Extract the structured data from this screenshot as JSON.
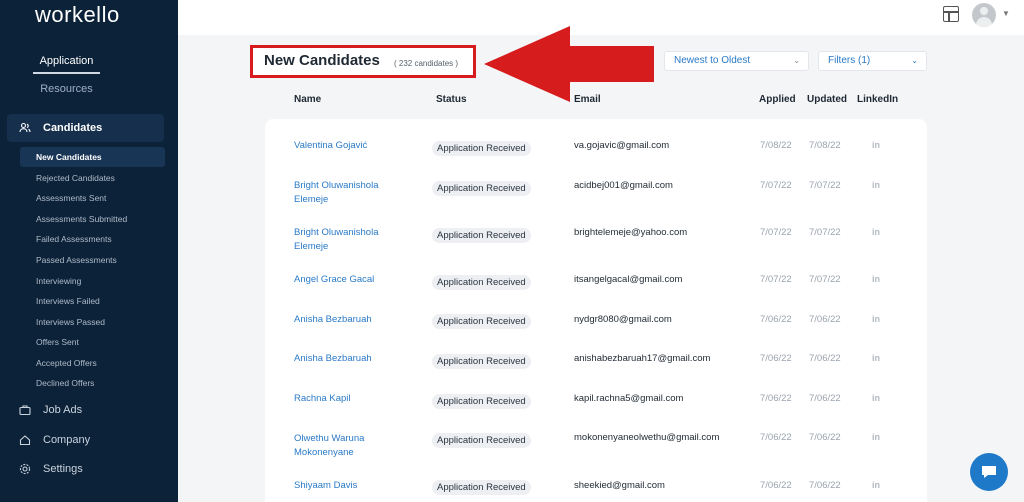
{
  "app": {
    "logo": "workello"
  },
  "topnav": {
    "application": "Application",
    "resources": "Resources"
  },
  "sidebar": {
    "candidates_label": "Candidates",
    "sub_items": [
      "New Candidates",
      "Rejected Candidates",
      "Assessments Sent",
      "Assessments Submitted",
      "Failed Assessments",
      "Passed Assessments",
      "Interviewing",
      "Interviews Failed",
      "Interviews Passed",
      "Offers Sent",
      "Accepted Offers",
      "Declined Offers"
    ],
    "job_ads": "Job Ads",
    "company": "Company",
    "settings": "Settings"
  },
  "page": {
    "title": "New Candidates",
    "count": "( 232 candidates )"
  },
  "controls": {
    "sort": "Newest to Oldest",
    "filters": "Filters (1)"
  },
  "headers": {
    "name": "Name",
    "status": "Status",
    "email": "Email",
    "applied": "Applied",
    "updated": "Updated",
    "linkedin": "LinkedIn"
  },
  "rows": [
    {
      "name": "Valentina Gojavić",
      "status": "Application Received",
      "email": "va.gojavic@gmail.com",
      "applied": "7/08/22",
      "updated": "7/08/22",
      "linkedin": "in"
    },
    {
      "name": "Bright Oluwanishola Elemeje",
      "status": "Application Received",
      "email": "acidbej001@gmail.com",
      "applied": "7/07/22",
      "updated": "7/07/22",
      "linkedin": "in"
    },
    {
      "name": "Bright Oluwanishola Elemeje",
      "status": "Application Received",
      "email": "brightelemeje@yahoo.com",
      "applied": "7/07/22",
      "updated": "7/07/22",
      "linkedin": "in"
    },
    {
      "name": "Angel Grace Gacal",
      "status": "Application Received",
      "email": "itsangelgacal@gmail.com",
      "applied": "7/07/22",
      "updated": "7/07/22",
      "linkedin": "in"
    },
    {
      "name": "Anisha Bezbaruah",
      "status": "Application Received",
      "email": "nydgr8080@gmail.com",
      "applied": "7/06/22",
      "updated": "7/06/22",
      "linkedin": "in"
    },
    {
      "name": "Anisha Bezbaruah",
      "status": "Application Received",
      "email": "anishabezbaruah17@gmail.com",
      "applied": "7/06/22",
      "updated": "7/06/22",
      "linkedin": "in"
    },
    {
      "name": "Rachna Kapil",
      "status": "Application Received",
      "email": "kapil.rachna5@gmail.com",
      "applied": "7/06/22",
      "updated": "7/06/22",
      "linkedin": "in"
    },
    {
      "name": "Olwethu Waruna Mokonenyane",
      "status": "Application Received",
      "email": "mokonenyaneolwethu@gmail.com",
      "applied": "7/06/22",
      "updated": "7/06/22",
      "linkedin": "in"
    },
    {
      "name": "Shiyaam Davis",
      "status": "Application Received",
      "email": "sheekied@gmail.com",
      "applied": "7/06/22",
      "updated": "7/06/22",
      "linkedin": "in"
    }
  ],
  "colors": {
    "sidebar_bg": "#0c2238",
    "accent": "#2a7ac7",
    "annotation_red": "#d61c1c",
    "chat": "#1e79c8"
  }
}
